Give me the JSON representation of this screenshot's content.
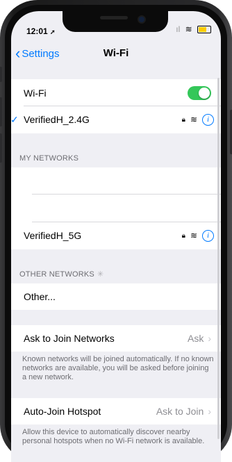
{
  "status_bar": {
    "time": "12:01",
    "location_icon": "location-arrow-icon",
    "signal_icon": "cell-signal-icon",
    "wifi_icon": "wifi-icon",
    "battery_icon": "battery-charging-icon"
  },
  "nav": {
    "back_label": "Settings",
    "title": "Wi-Fi"
  },
  "wifi_toggle": {
    "label": "Wi-Fi",
    "on": true
  },
  "connected_network": {
    "name": "VerifiedH_2.4G"
  },
  "my_networks": {
    "header": "MY NETWORKS",
    "items": [
      {
        "name": ""
      },
      {
        "name": ""
      },
      {
        "name": "VerifiedH_5G"
      }
    ]
  },
  "other_networks": {
    "header": "OTHER NETWORKS",
    "other_label": "Other..."
  },
  "ask_to_join": {
    "label": "Ask to Join Networks",
    "value": "Ask",
    "footnote": "Known networks will be joined automatically. If no known networks are available, you will be asked before joining a new network."
  },
  "auto_join_hotspot": {
    "label": "Auto-Join Hotspot",
    "value": "Ask to Join",
    "footnote": "Allow this device to automatically discover nearby personal hotspots when no Wi-Fi network is available."
  },
  "colors": {
    "accent": "#007aff",
    "toggle_on": "#34c759",
    "background": "#efeff4"
  }
}
